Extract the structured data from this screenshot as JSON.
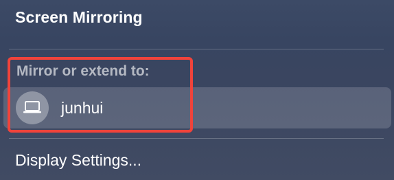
{
  "menu": {
    "title": "Screen Mirroring",
    "section_label": "Mirror or extend to:",
    "devices": [
      {
        "name": "junhui",
        "icon": "laptop-icon"
      }
    ],
    "footer_item": "Display Settings..."
  },
  "colors": {
    "highlight_border": "#f0433b"
  }
}
